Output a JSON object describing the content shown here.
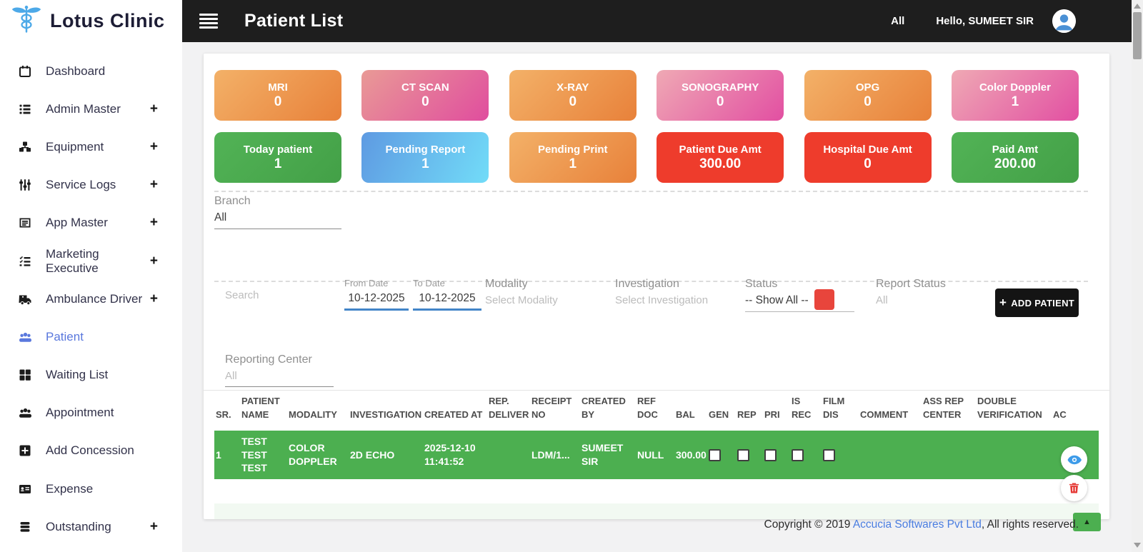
{
  "brand": {
    "name": "Lotus Clinic"
  },
  "header": {
    "title": "Patient List",
    "all_label": "All",
    "greeting": "Hello, SUMEET SIR"
  },
  "sidebar": {
    "expand_glyph": "+",
    "items": [
      {
        "label": "Dashboard",
        "icon": "calendar-icon",
        "expandable": false,
        "active": false
      },
      {
        "label": "Admin Master",
        "icon": "list-icon",
        "expandable": true,
        "active": false
      },
      {
        "label": "Equipment",
        "icon": "cubes-icon",
        "expandable": true,
        "active": false
      },
      {
        "label": "Service Logs",
        "icon": "sliders-icon",
        "expandable": true,
        "active": false
      },
      {
        "label": "App Master",
        "icon": "list-alt-icon",
        "expandable": true,
        "active": false
      },
      {
        "label": "Marketing Executive",
        "icon": "tasks-icon",
        "expandable": true,
        "active": false
      },
      {
        "label": "Ambulance Driver",
        "icon": "ambulance-icon",
        "expandable": true,
        "active": false
      },
      {
        "label": "Patient",
        "icon": "users-icon",
        "expandable": false,
        "active": true
      },
      {
        "label": "Waiting List",
        "icon": "grid-icon",
        "expandable": false,
        "active": false
      },
      {
        "label": "Appointment",
        "icon": "users-icon",
        "expandable": false,
        "active": false
      },
      {
        "label": "Add Concession",
        "icon": "plus-square-icon",
        "expandable": false,
        "active": false
      },
      {
        "label": "Expense",
        "icon": "id-card-icon",
        "expandable": false,
        "active": false
      },
      {
        "label": "Outstanding",
        "icon": "layers-icon",
        "expandable": true,
        "active": false
      }
    ]
  },
  "stat_cards": {
    "row1": [
      {
        "label": "MRI",
        "value": "0",
        "theme": "orange"
      },
      {
        "label": "CT SCAN",
        "value": "0",
        "theme": "pink"
      },
      {
        "label": "X-RAY",
        "value": "0",
        "theme": "orange"
      },
      {
        "label": "SONOGRAPHY",
        "value": "0",
        "theme": "pink"
      },
      {
        "label": "OPG",
        "value": "0",
        "theme": "orange"
      },
      {
        "label": "Color Doppler",
        "value": "1",
        "theme": "pink"
      }
    ],
    "row2": [
      {
        "label": "Today patient",
        "value": "1",
        "theme": "green"
      },
      {
        "label": "Pending Report",
        "value": "1",
        "theme": "blue"
      },
      {
        "label": "Pending Print",
        "value": "1",
        "theme": "orange"
      },
      {
        "label": "Patient Due Amt",
        "value": "300.00",
        "theme": "red"
      },
      {
        "label": "Hospital Due Amt",
        "value": "0",
        "theme": "red"
      },
      {
        "label": "Paid Amt",
        "value": "200.00",
        "theme": "green"
      }
    ]
  },
  "filters": {
    "branch": {
      "label": "Branch",
      "value": "All"
    },
    "search": {
      "placeholder": "Search"
    },
    "from_date": {
      "label": "From Date",
      "value": "10-12-2025"
    },
    "to_date": {
      "label": "To Date",
      "value": "10-12-2025"
    },
    "modality": {
      "label": "Modality",
      "placeholder": "Select Modality"
    },
    "investigation": {
      "label": "Investigation",
      "placeholder": "Select Investigation"
    },
    "status": {
      "label": "Status",
      "value": "-- Show All --"
    },
    "report_status": {
      "label": "Report Status",
      "placeholder": "All"
    },
    "reporting_center": {
      "label": "Reporting Center",
      "placeholder": "All"
    },
    "add_patient_plus": "+",
    "add_patient_label": "ADD PATIENT"
  },
  "table": {
    "columns": [
      "SR.",
      "PATIENT NAME",
      "MODALITY",
      "INVESTIGATION",
      "CREATED AT",
      "REP. DELIVER",
      "RECEIPT NO",
      "CREATED BY",
      "REF DOC",
      "BAL",
      "GEN",
      "REP",
      "PRI",
      "IS REC",
      "FILM DIS",
      "COMMENT",
      "ASS REP CENTER",
      "DOUBLE VERIFICATION",
      "AC"
    ],
    "rows": [
      {
        "sr": "1",
        "patient_name": "TEST TEST TEST",
        "modality": "COLOR DOPPLER",
        "investigation": "2D ECHO",
        "created_at": "2025-12-10 11:41:52",
        "rep_deliver": "",
        "receipt_no": "LDM/1...",
        "created_by": "SUMEET SIR",
        "ref_doc": "NULL",
        "bal": "300.00",
        "checks": {
          "gen": false,
          "rep": false,
          "pri": false,
          "is_rec": false,
          "film_dis": false
        },
        "comment": "",
        "ass_rep_center": "",
        "double_verification": ""
      }
    ]
  },
  "footer": {
    "prefix": "Copyright © 2019 ",
    "link": "Accucia Softwares Pvt Ltd",
    "suffix": ", All rights reserved.",
    "scrolltop_glyph": "▲"
  },
  "colors": {
    "header_bg": "#1e1e1e",
    "brand_blue": "#4da9e8",
    "active_blue": "#5a78dd",
    "card_orange": "#e8813a",
    "card_pink": "#e04d9e",
    "card_green": "#4caf50",
    "card_blue": "#5e9ae2",
    "card_red": "#ee3c2c",
    "row_green": "#4caf50",
    "date_underline": "#4285c8",
    "status_indicator_red": "#e8453c",
    "link_blue": "#4a7de0"
  }
}
